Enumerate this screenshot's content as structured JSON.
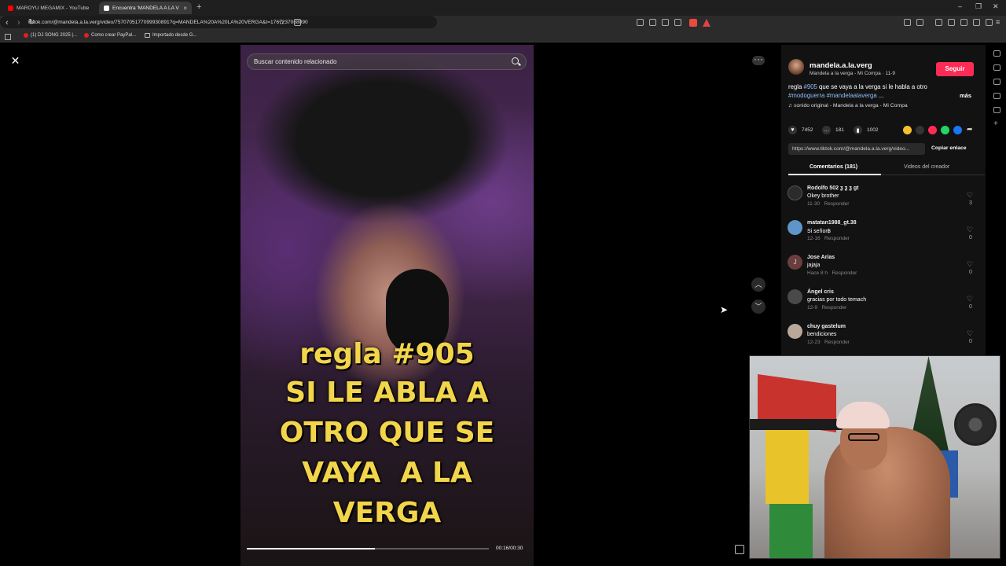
{
  "browser": {
    "tabs": [
      {
        "label": "MAROYU MEGAMIX - YouTube",
        "favicon_color": "#ff0000"
      },
      {
        "label": "Encuentra 'MANDELA A LA V",
        "favicon_color": "#ffffff"
      }
    ],
    "url": "tiktok.com/@mandela.a.la.verg/video/7570705177099930891?q=MANDELA%20A%20LA%20VERGA&t=1767237068090",
    "bookmarks": [
      "(1) DJ SONG 2025 |...",
      "Como crear PayPal...",
      "Importado desde G..."
    ]
  },
  "search": {
    "placeholder": "Buscar contenido relacionado"
  },
  "video": {
    "caption_lines": [
      "regla #905",
      "SI LE ABLA A",
      "OTRO QUE SE",
      "VAYA  A LA",
      "VERGA"
    ],
    "time": "00:16/00:30",
    "progress": 0.53
  },
  "author": {
    "username": "mandela.a.la.verg",
    "subtitle": "Mandela a la verga - Mi Compa · 11-9",
    "follow_label": "Seguir"
  },
  "description": {
    "text_start": "regla ",
    "tag1": "#905",
    "text_mid": " que se vaya a la verga si le habla a otro ",
    "tag2": "#modoguerra",
    "tag3": "#mandelaalaverga",
    "ellipsis": " ...",
    "more": "más"
  },
  "sound": "♫  sonido original - Mandela a la verga - Mi Compa",
  "stats": {
    "likes": "7452",
    "comments": "181",
    "saves": "1002"
  },
  "link": {
    "url": "https://www.tiktok.com/@mandela.a.la.verg/video...",
    "copy_label": "Copiar enlace"
  },
  "tabs": {
    "comments": "Comentarios (181)",
    "videos": "Videos del creador"
  },
  "comments": [
    {
      "name": "Rodolfo 502 ƺ ƺ ƺ gt",
      "text": "Okey brother",
      "date": "11-30",
      "reply": "Responder",
      "likes": "3",
      "avatar_color": "#333333"
    },
    {
      "name": "matatan1988_gt.38",
      "text": "Si señor฿",
      "date": "12-16",
      "reply": "Responder",
      "likes": "0",
      "avatar_color": "#5f95c8"
    },
    {
      "name": "Jose Arias",
      "text": "jajaja",
      "date": "Hace 8 h",
      "reply": "Responder",
      "likes": "0",
      "avatar_color": "#6b3e3e",
      "initial": "J"
    },
    {
      "name": "Ángel cris",
      "text": "gracias por todo temach",
      "date": "12-9",
      "reply": "Responder",
      "likes": "0",
      "avatar_color": "#4a4a4a"
    },
    {
      "name": "chuy gastelum",
      "text": "bendiciones",
      "date": "12-23",
      "reply": "Responder",
      "likes": "0",
      "avatar_color": "#b9a89a"
    }
  ],
  "colors": {
    "accent": "#fe2c55",
    "hashtag": "#8fbff6",
    "caption": "#f2d54a"
  },
  "icons": [
    "close-icon",
    "search-icon",
    "more-icon",
    "chevron-up-icon",
    "chevron-down-icon",
    "heart-icon",
    "comment-icon",
    "bookmark-icon",
    "music-icon"
  ]
}
